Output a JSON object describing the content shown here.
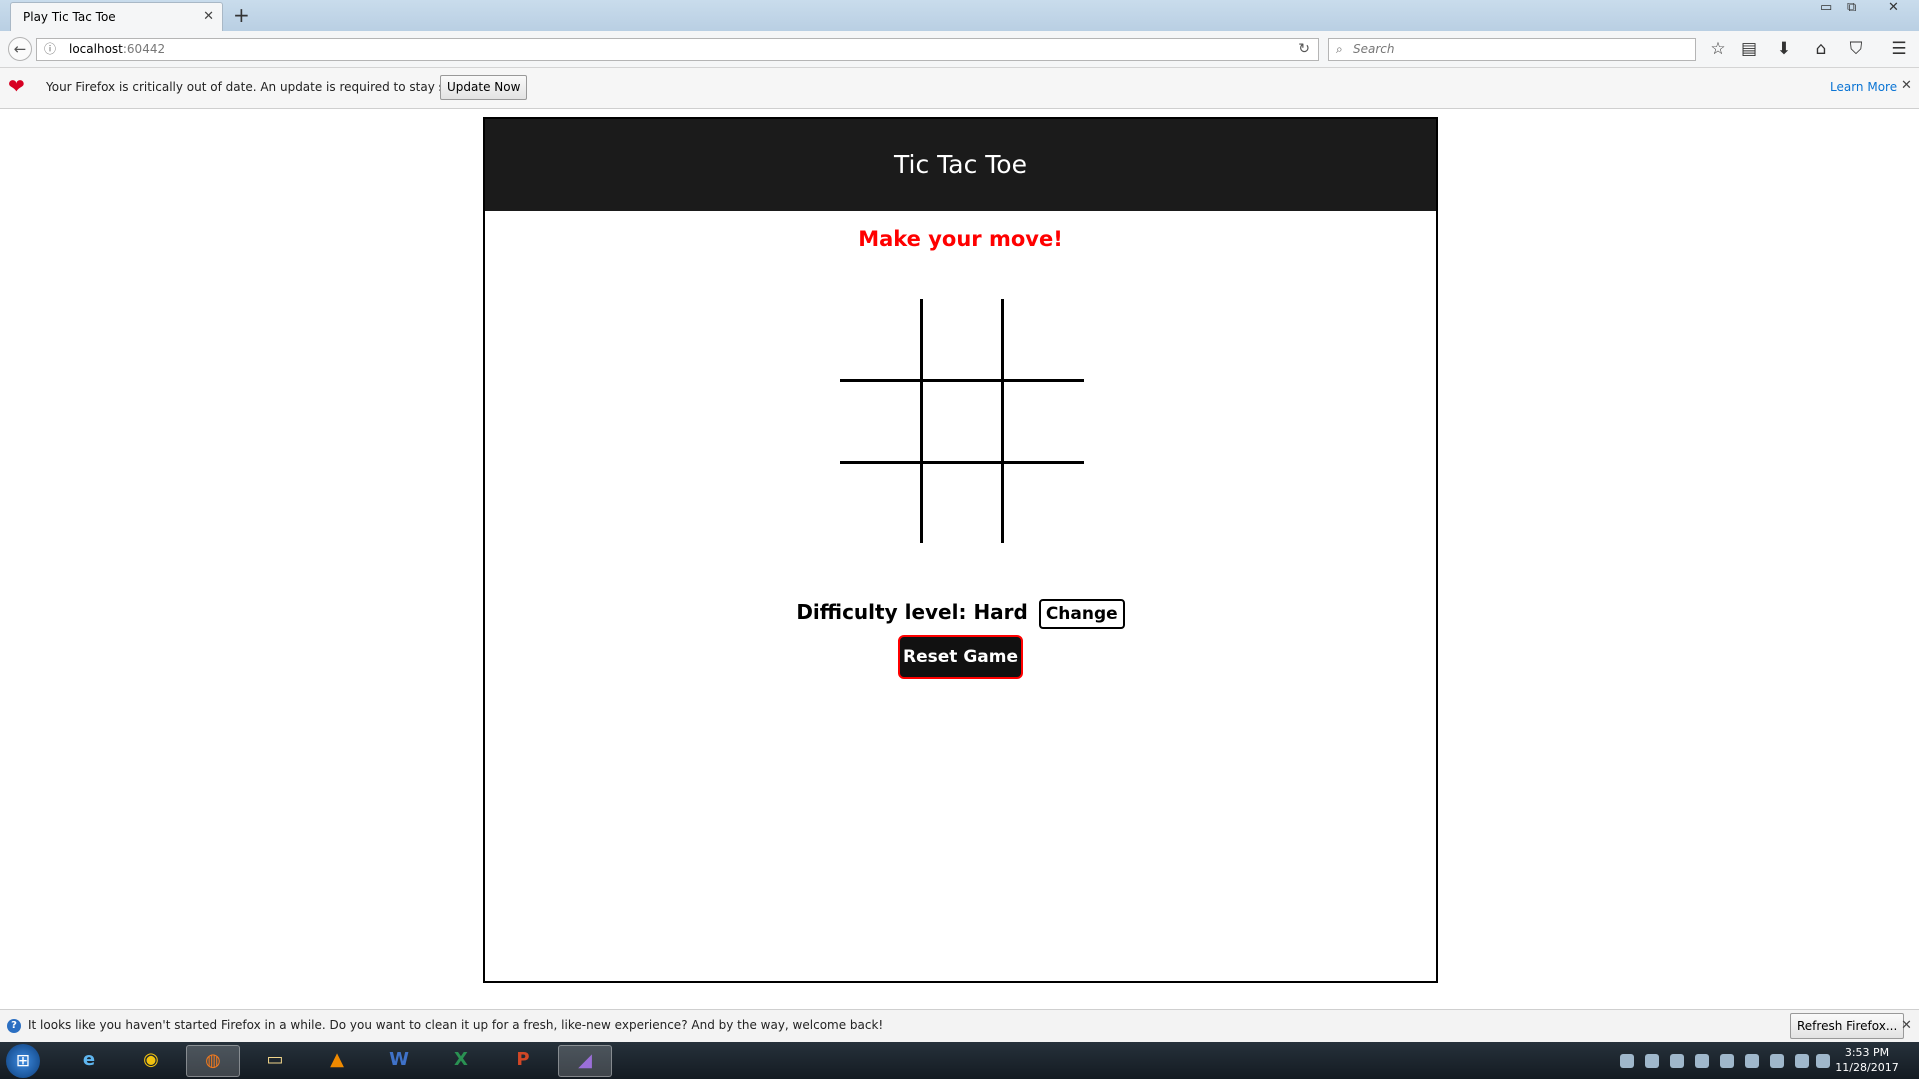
{
  "browser": {
    "tab_title": "Play Tic Tac Toe",
    "url_host": "localhost",
    "url_port": ":60442",
    "search_placeholder": "Search",
    "window_controls": {
      "minimize": "▭",
      "restore": "⧉",
      "close": "✕"
    }
  },
  "update_bar": {
    "message": "Your Firefox is critically out of date. An update is required to stay secure",
    "button_label": "Update Now",
    "learn_more": "Learn More"
  },
  "game": {
    "title": "Tic Tac Toe",
    "status": "Make your move!",
    "board": [
      "",
      "",
      "",
      "",
      "",
      "",
      "",
      "",
      ""
    ],
    "difficulty_label": "Difficulty level:",
    "difficulty_value": "Hard",
    "change_label": "Change",
    "reset_label": "Reset Game"
  },
  "bottom_bar": {
    "message": "It looks like you haven't started Firefox in a while. Do you want to clean it up for a fresh, like-new experience? And by the way, welcome back!",
    "button_label": "Refresh Firefox..."
  },
  "taskbar": {
    "apps": [
      "Internet Explorer",
      "Chrome",
      "Firefox",
      "File Explorer",
      "VLC",
      "Word",
      "Excel",
      "PowerPoint",
      "Visual Studio"
    ],
    "time": "3:53 PM",
    "date": "11/28/2017"
  }
}
